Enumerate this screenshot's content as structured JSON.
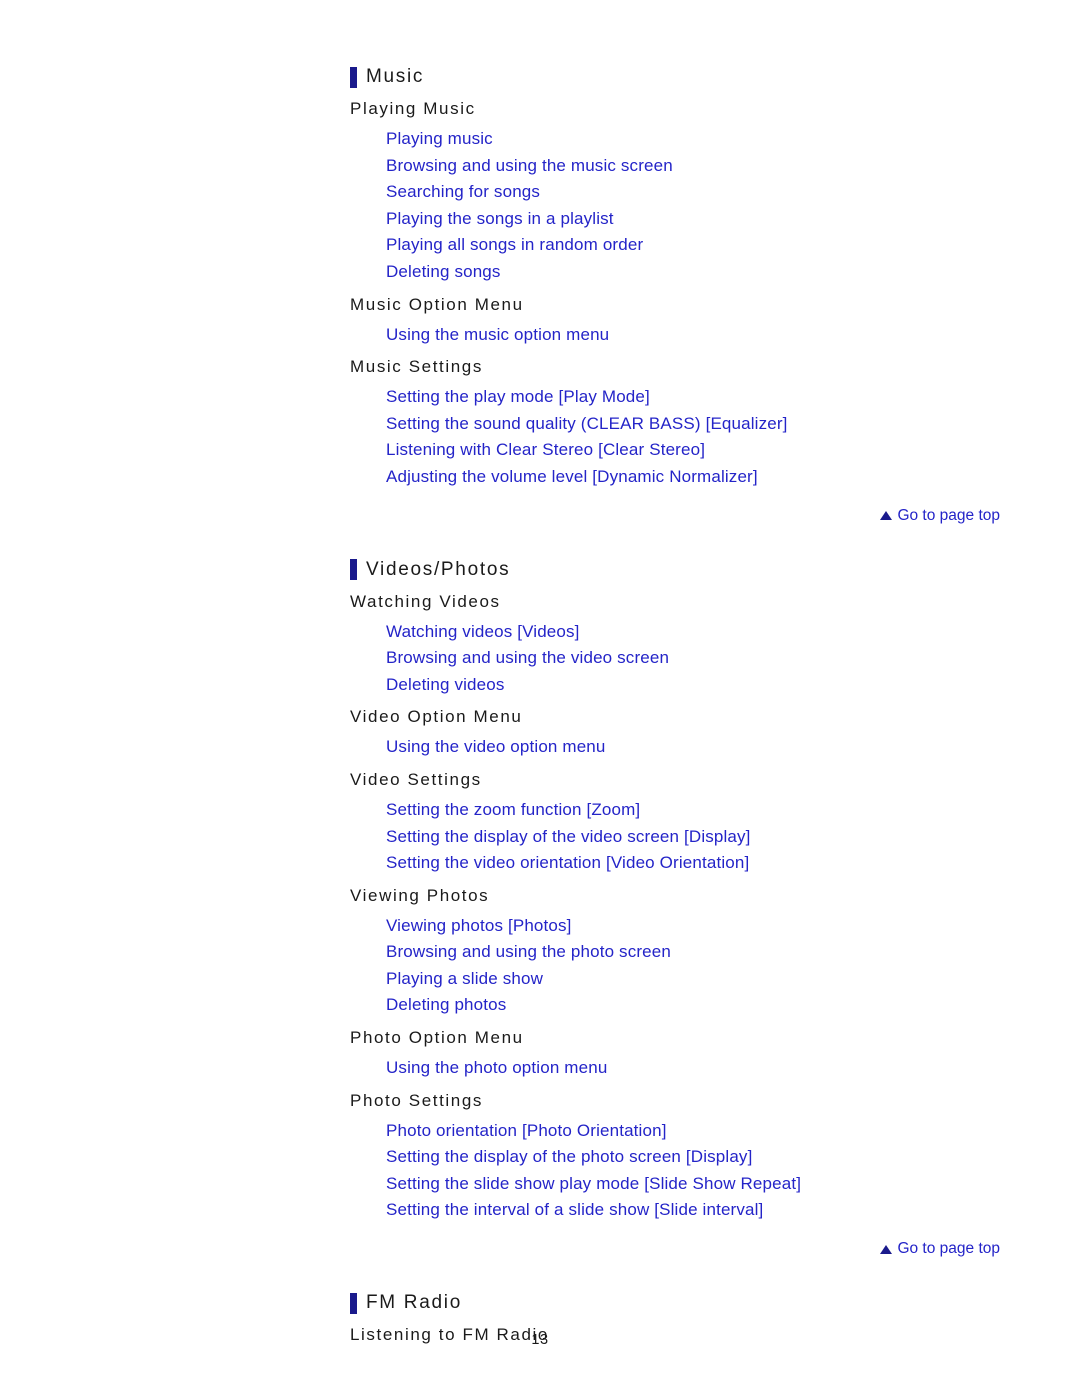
{
  "document": {
    "page_number": "13"
  },
  "icons": {
    "section_bar": "vertical-bar-icon",
    "page_top_triangle": "triangle-up-icon"
  },
  "colors": {
    "link": "#2424c8",
    "section_bar": "#1a1a8c",
    "heading_text": "#1a1a1a",
    "background": "#ffffff"
  },
  "page_top_label": "Go to page top",
  "sections": [
    {
      "title": "Music",
      "groups": [
        {
          "heading": "Playing Music",
          "links": [
            "Playing music",
            "Browsing and using the music screen",
            "Searching for songs",
            "Playing the songs in a playlist",
            "Playing all songs in random order",
            "Deleting songs"
          ]
        },
        {
          "heading": "Music Option Menu",
          "links": [
            "Using the music option menu"
          ]
        },
        {
          "heading": "Music Settings",
          "links": [
            "Setting the play mode [Play Mode]",
            "Setting the sound quality (CLEAR BASS) [Equalizer]",
            "Listening with Clear Stereo [Clear Stereo]",
            "Adjusting the volume level [Dynamic Normalizer]"
          ]
        }
      ]
    },
    {
      "title": "Videos/Photos",
      "groups": [
        {
          "heading": "Watching Videos",
          "links": [
            "Watching videos [Videos]",
            "Browsing and using the video screen",
            "Deleting videos"
          ]
        },
        {
          "heading": "Video Option Menu",
          "links": [
            "Using the video option menu"
          ]
        },
        {
          "heading": "Video Settings",
          "links": [
            "Setting the zoom function [Zoom]",
            "Setting the display of the video screen [Display]",
            "Setting the video orientation [Video Orientation]"
          ]
        },
        {
          "heading": "Viewing Photos",
          "links": [
            "Viewing photos [Photos]",
            "Browsing and using the photo screen",
            "Playing a slide show",
            "Deleting photos"
          ]
        },
        {
          "heading": "Photo Option Menu",
          "links": [
            "Using the photo option menu"
          ]
        },
        {
          "heading": "Photo Settings",
          "links": [
            "Photo orientation [Photo Orientation]",
            "Setting the display of the photo screen [Display]",
            "Setting the slide show play mode [Slide Show Repeat]",
            "Setting the interval of a slide show [Slide interval]"
          ]
        }
      ]
    },
    {
      "title": "FM Radio",
      "groups": [
        {
          "heading": "Listening to FM Radio",
          "links": []
        }
      ]
    }
  ]
}
